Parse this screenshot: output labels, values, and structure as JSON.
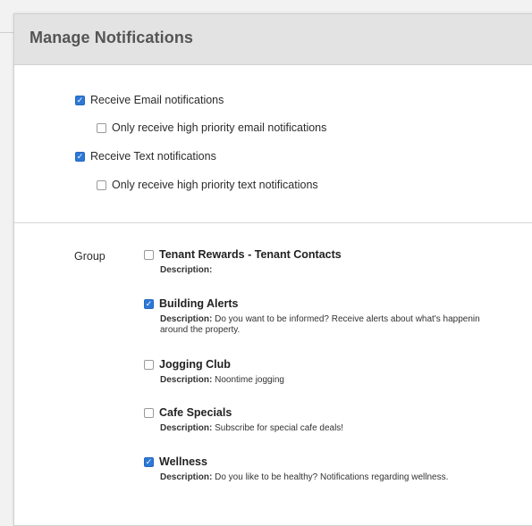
{
  "panel": {
    "title": "Manage Notifications"
  },
  "options": [
    {
      "label": "Receive Email notifications",
      "checked": true
    },
    {
      "label": "Only receive high priority email notifications",
      "checked": false
    },
    {
      "label": "Receive Text notifications",
      "checked": true
    },
    {
      "label": "Only receive high priority text notifications",
      "checked": false
    }
  ],
  "group_label": "Group",
  "description_label": "Description:",
  "groups": [
    {
      "name": "Tenant Rewards - Tenant Contacts",
      "checked": false,
      "description_lines": [
        "",
        ""
      ]
    },
    {
      "name": "Building Alerts",
      "checked": true,
      "description_lines": [
        "Do you want to be informed? Receive alerts about what's happenin",
        "around the property."
      ]
    },
    {
      "name": "Jogging Club",
      "checked": false,
      "description_lines": [
        "Noontime jogging",
        ""
      ]
    },
    {
      "name": "Cafe Specials",
      "checked": false,
      "description_lines": [
        "Subscribe for special cafe deals!",
        ""
      ]
    },
    {
      "name": "Wellness",
      "checked": true,
      "description_lines": [
        "Do you like to be healthy? Notifications regarding wellness.",
        ""
      ]
    }
  ],
  "colors": {
    "checkbox_checked": "#2d78d6",
    "header_bg": "#e3e3e3",
    "title_text": "#555555"
  }
}
